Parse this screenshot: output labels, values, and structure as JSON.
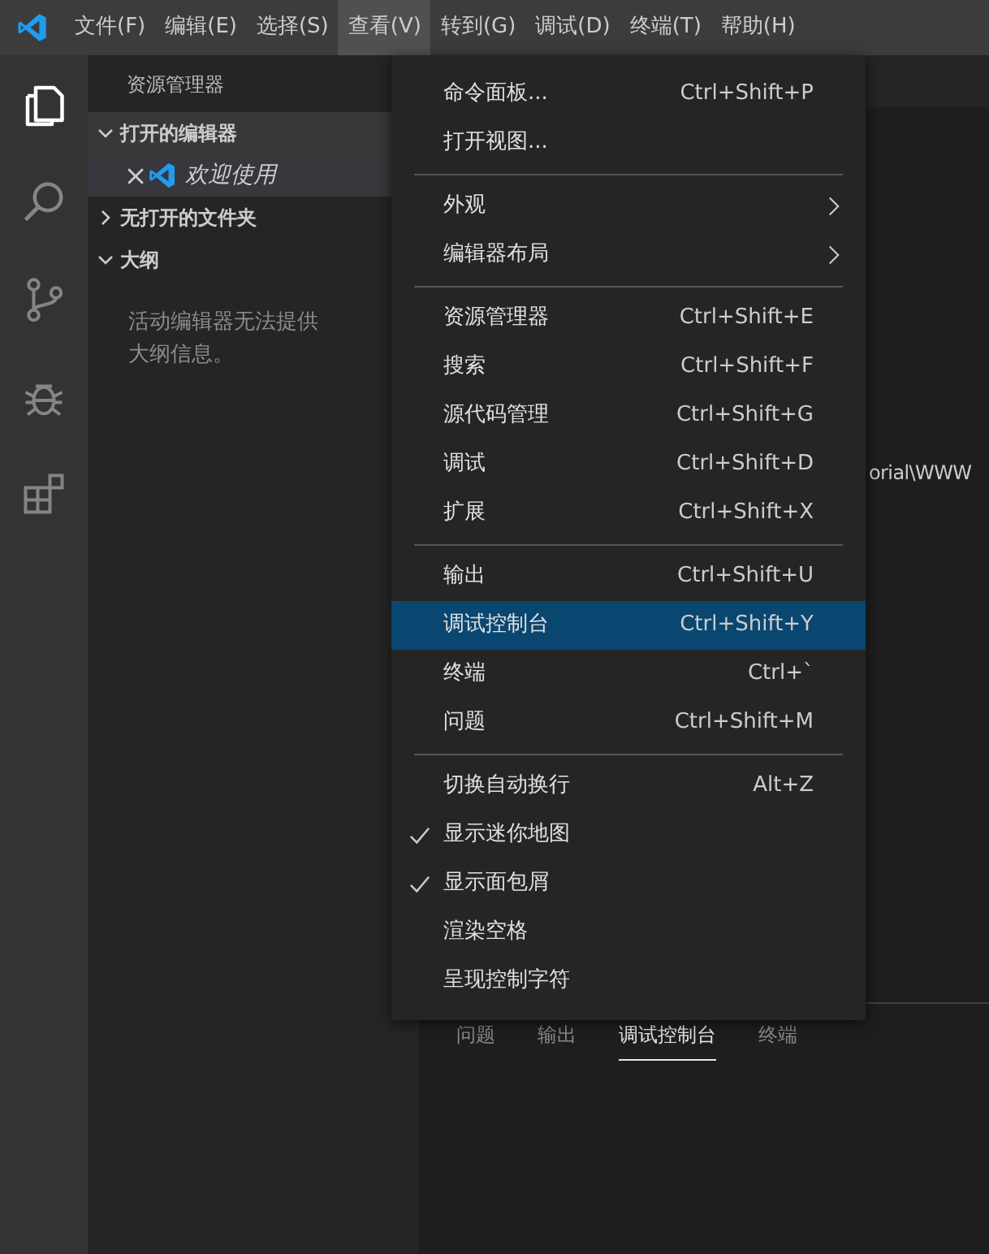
{
  "menubar": [
    {
      "label": "文件(F)",
      "selected": false
    },
    {
      "label": "编辑(E)",
      "selected": false
    },
    {
      "label": "选择(S)",
      "selected": false
    },
    {
      "label": "查看(V)",
      "selected": true
    },
    {
      "label": "转到(G)",
      "selected": false
    },
    {
      "label": "调试(D)",
      "selected": false
    },
    {
      "label": "终端(T)",
      "selected": false
    },
    {
      "label": "帮助(H)",
      "selected": false
    }
  ],
  "activity_bar": [
    {
      "kind": "files",
      "selected": true
    },
    {
      "kind": "search",
      "selected": false
    },
    {
      "kind": "source-control",
      "selected": false
    },
    {
      "kind": "debug",
      "selected": false
    },
    {
      "kind": "extensions",
      "selected": false
    }
  ],
  "sidebar": {
    "title": "资源管理器",
    "sections": [
      {
        "label": "打开的编辑器",
        "expanded": true,
        "items": [
          {
            "label": "欢迎使用"
          }
        ]
      },
      {
        "label": "无打开的文件夹",
        "expanded": false
      },
      {
        "label": "大纲",
        "expanded": true,
        "message": "活动编辑器无法提供大纲信息。"
      }
    ]
  },
  "editor": {
    "text": "orial\\WWW"
  },
  "panel": {
    "tabs": [
      {
        "label": "问题",
        "selected": false
      },
      {
        "label": "输出",
        "selected": false
      },
      {
        "label": "调试控制台",
        "selected": true
      },
      {
        "label": "终端",
        "selected": false
      }
    ]
  },
  "menu": {
    "items": [
      {
        "kind": "item",
        "label": "命令面板...",
        "shortcut": "Ctrl+Shift+P",
        "checked": false,
        "submenu": false,
        "selected": false
      },
      {
        "kind": "item",
        "label": "打开视图...",
        "checked": false,
        "submenu": false,
        "selected": false
      },
      {
        "kind": "separator"
      },
      {
        "kind": "item",
        "label": "外观",
        "checked": false,
        "submenu": true,
        "selected": false
      },
      {
        "kind": "item",
        "label": "编辑器布局",
        "checked": false,
        "submenu": true,
        "selected": false
      },
      {
        "kind": "separator"
      },
      {
        "kind": "item",
        "label": "资源管理器",
        "shortcut": "Ctrl+Shift+E",
        "checked": false,
        "submenu": false,
        "selected": false
      },
      {
        "kind": "item",
        "label": "搜索",
        "shortcut": "Ctrl+Shift+F",
        "checked": false,
        "submenu": false,
        "selected": false
      },
      {
        "kind": "item",
        "label": "源代码管理",
        "shortcut": "Ctrl+Shift+G",
        "checked": false,
        "submenu": false,
        "selected": false
      },
      {
        "kind": "item",
        "label": "调试",
        "shortcut": "Ctrl+Shift+D",
        "checked": false,
        "submenu": false,
        "selected": false
      },
      {
        "kind": "item",
        "label": "扩展",
        "shortcut": "Ctrl+Shift+X",
        "checked": false,
        "submenu": false,
        "selected": false
      },
      {
        "kind": "separator"
      },
      {
        "kind": "item",
        "label": "输出",
        "shortcut": "Ctrl+Shift+U",
        "checked": false,
        "submenu": false,
        "selected": false
      },
      {
        "kind": "item",
        "label": "调试控制台",
        "shortcut": "Ctrl+Shift+Y",
        "checked": false,
        "submenu": false,
        "selected": true
      },
      {
        "kind": "item",
        "label": "终端",
        "shortcut": "Ctrl+`",
        "checked": false,
        "submenu": false,
        "selected": false
      },
      {
        "kind": "item",
        "label": "问题",
        "shortcut": "Ctrl+Shift+M",
        "checked": false,
        "submenu": false,
        "selected": false
      },
      {
        "kind": "separator"
      },
      {
        "kind": "item",
        "label": "切换自动换行",
        "shortcut": "Alt+Z",
        "checked": false,
        "submenu": false,
        "selected": false
      },
      {
        "kind": "item",
        "label": "显示迷你地图",
        "checked": true,
        "submenu": false,
        "selected": false
      },
      {
        "kind": "item",
        "label": "显示面包屑",
        "checked": true,
        "submenu": false,
        "selected": false
      },
      {
        "kind": "item",
        "label": "渲染空格",
        "checked": false,
        "submenu": false,
        "selected": false
      },
      {
        "kind": "item",
        "label": "呈现控制字符",
        "checked": false,
        "submenu": false,
        "selected": false
      }
    ]
  }
}
